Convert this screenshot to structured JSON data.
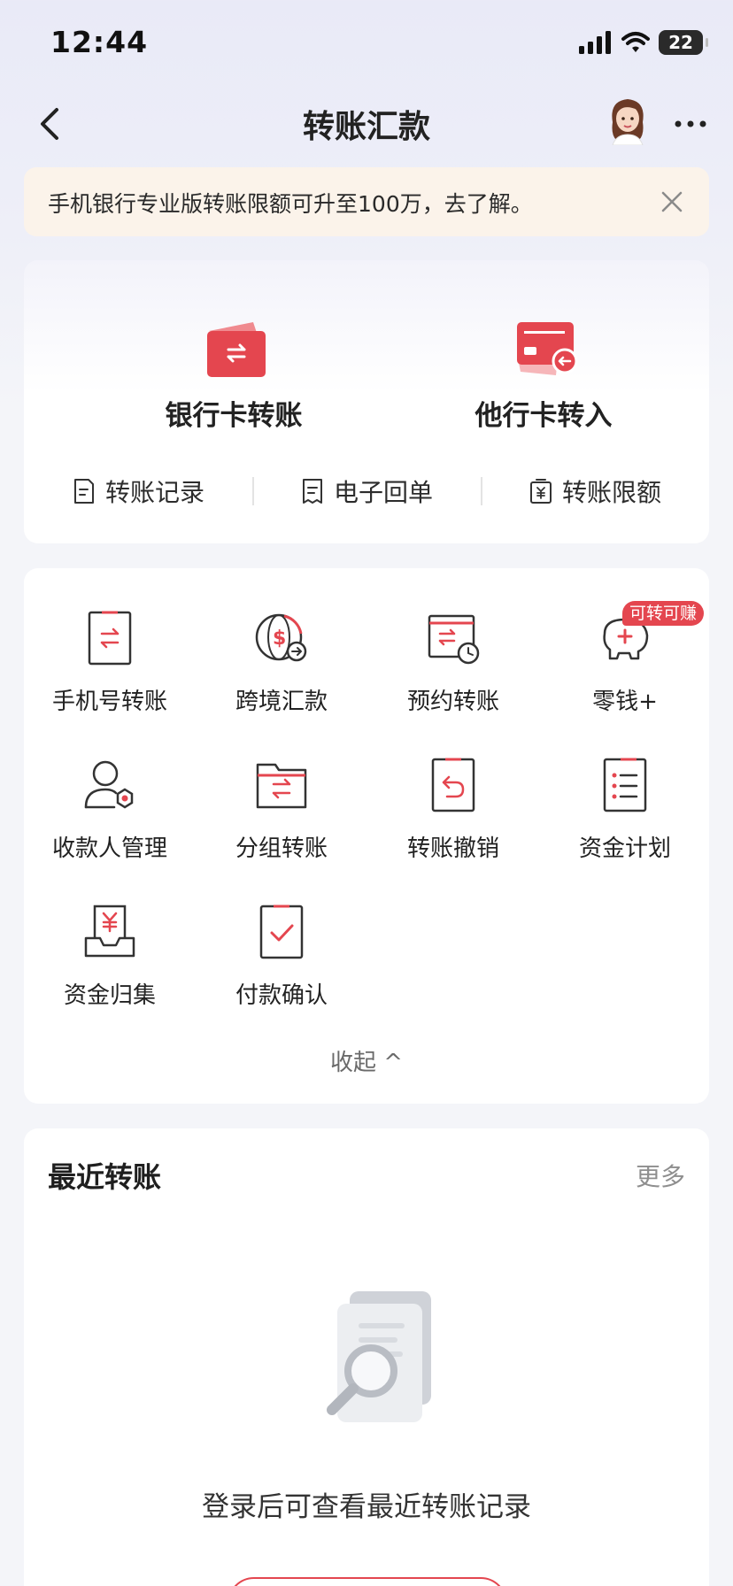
{
  "status": {
    "time": "12:44",
    "battery": "22"
  },
  "nav": {
    "title": "转账汇款"
  },
  "notice": {
    "text": "手机银行专业版转账限额可升至100万，去了解。"
  },
  "main_actions": [
    {
      "label": "银行卡转账",
      "icon": "bank-card-transfer-icon"
    },
    {
      "label": "他行卡转入",
      "icon": "other-bank-card-in-icon"
    }
  ],
  "sub_actions": [
    {
      "label": "转账记录",
      "icon": "record-icon"
    },
    {
      "label": "电子回单",
      "icon": "receipt-icon"
    },
    {
      "label": "转账限额",
      "icon": "limit-icon"
    }
  ],
  "grid": [
    {
      "label": "手机号转账",
      "icon": "phone-transfer-icon"
    },
    {
      "label": "跨境汇款",
      "icon": "cross-border-icon"
    },
    {
      "label": "预约转账",
      "icon": "scheduled-transfer-icon"
    },
    {
      "label": "零钱+",
      "icon": "piggy-bank-icon"
    },
    {
      "label": "收款人管理",
      "icon": "payee-manage-icon"
    },
    {
      "label": "分组转账",
      "icon": "group-transfer-icon"
    },
    {
      "label": "转账撤销",
      "icon": "transfer-revoke-icon"
    },
    {
      "label": "资金计划",
      "icon": "fund-plan-icon"
    },
    {
      "label": "资金归集",
      "icon": "fund-collect-icon"
    },
    {
      "label": "付款确认",
      "icon": "payment-confirm-icon"
    }
  ],
  "badge": "可转可赚",
  "collapse": "收起 ^",
  "recent": {
    "title": "最近转账",
    "more": "更多",
    "empty_text": "登录后可查看最近转账记录"
  },
  "colors": {
    "accent": "#e4464f",
    "notice_bg": "#fbf3ea"
  }
}
